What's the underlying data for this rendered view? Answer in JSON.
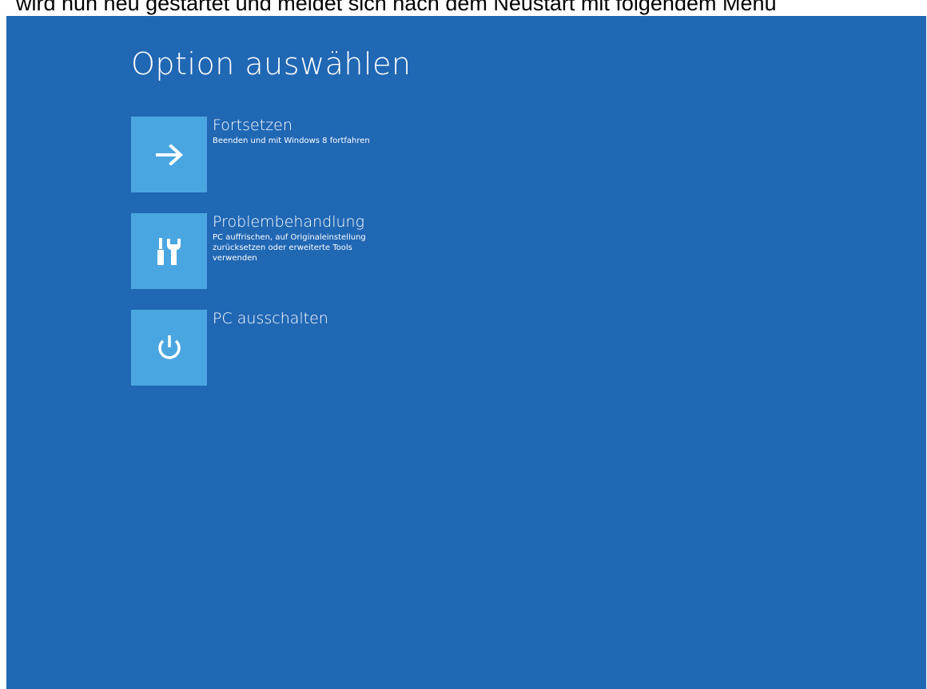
{
  "caption": "wird nun neu gestartet und meldet sich nach dem Neustart mit folgendem Menü",
  "screen": {
    "title": "Option auswählen",
    "options": [
      {
        "title": "Fortsetzen",
        "description": "Beenden und mit Windows 8 fortfahren",
        "icon": "arrow-right-icon"
      },
      {
        "title": "Problembehandlung",
        "description": "PC auffrischen, auf Originaleinstellung zurücksetzen oder erweiterte Tools verwenden",
        "icon": "tools-icon"
      },
      {
        "title": "PC ausschalten",
        "description": "",
        "icon": "power-icon"
      }
    ]
  },
  "colors": {
    "background": "#2067b4",
    "tile": "#4aa6e0",
    "text": "#ffffff"
  }
}
